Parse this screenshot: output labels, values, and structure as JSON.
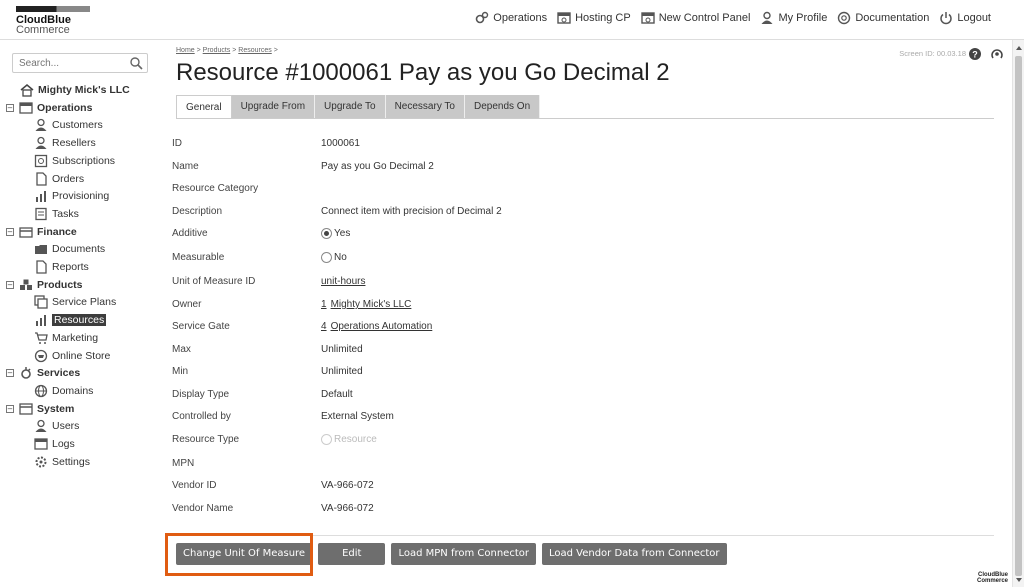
{
  "header": {
    "brand_line1": "CloudBlue",
    "brand_line2": "Commerce",
    "nav": [
      "Operations",
      "Hosting CP",
      "New Control Panel",
      "My Profile",
      "Documentation",
      "Logout"
    ]
  },
  "sidebar": {
    "search_placeholder": "Search...",
    "account": "Mighty Mick's LLC",
    "sections": [
      {
        "label": "Operations",
        "items": [
          "Customers",
          "Resellers",
          "Subscriptions",
          "Orders",
          "Provisioning",
          "Tasks"
        ]
      },
      {
        "label": "Finance",
        "items": [
          "Documents",
          "Reports"
        ]
      },
      {
        "label": "Products",
        "items": [
          "Service Plans",
          "Resources",
          "Marketing",
          "Online Store"
        ]
      },
      {
        "label": "Services",
        "items": [
          "Domains"
        ]
      },
      {
        "label": "System",
        "items": [
          "Users",
          "Logs",
          "Settings"
        ]
      }
    ],
    "selected": "Resources"
  },
  "main": {
    "breadcrumb": [
      "Home",
      "Products",
      "Resources"
    ],
    "title": "Resource #1000061 Pay as you Go Decimal 2",
    "screen_id": "Screen ID: 00.03.18",
    "tabs": [
      "General",
      "Upgrade From",
      "Upgrade To",
      "Necessary To",
      "Depends On"
    ],
    "active_tab": "General",
    "fields": [
      {
        "label": "ID",
        "value": "1000061"
      },
      {
        "label": "Name",
        "value": "Pay as you Go Decimal 2"
      },
      {
        "label": "Resource Category",
        "value": ""
      },
      {
        "label": "Description",
        "value": "Connect item with precision of Decimal 2"
      },
      {
        "label": "Additive",
        "value": "Yes"
      },
      {
        "label": "Measurable",
        "value": "No"
      },
      {
        "label": "Unit of Measure ID",
        "value": "unit-hours"
      },
      {
        "label": "Owner",
        "value_num": "1",
        "value": "Mighty Mick's LLC"
      },
      {
        "label": "Service Gate",
        "value_num": "4",
        "value": "Operations Automation"
      },
      {
        "label": "Max",
        "value": "Unlimited"
      },
      {
        "label": "Min",
        "value": "Unlimited"
      },
      {
        "label": "Display Type",
        "value": "Default"
      },
      {
        "label": "Controlled by",
        "value": "External System"
      },
      {
        "label": "Resource Type",
        "value": "Resource"
      },
      {
        "label": "MPN",
        "value": ""
      },
      {
        "label": "Vendor ID",
        "value": "VA-966-072"
      },
      {
        "label": "Vendor Name",
        "value": "VA-966-072"
      }
    ],
    "buttons": [
      "Change Unit Of Measure",
      "Edit",
      "Load MPN from Connector",
      "Load Vendor Data from Connector"
    ]
  },
  "footer": {
    "brand_line1": "CloudBlue",
    "brand_line2": "Commerce"
  },
  "colors": {
    "highlight": "#e05c12",
    "button": "#6e6e6e",
    "tab_inactive": "#c8c8c8"
  }
}
